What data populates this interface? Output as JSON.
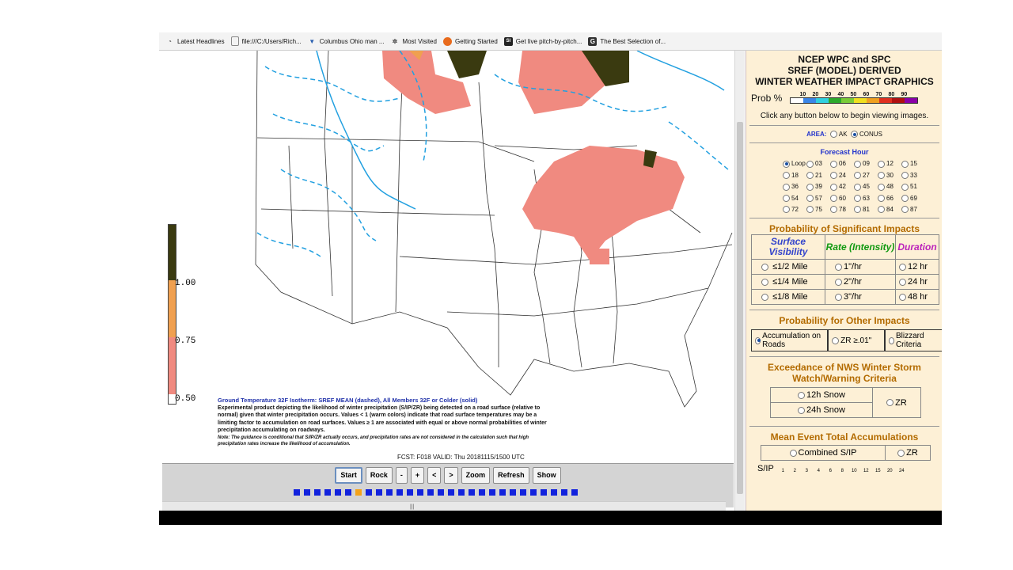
{
  "bookmarks": [
    {
      "label": "Latest Headlines",
      "icon": "rss-icon"
    },
    {
      "label": "file:///C:/Users/Rich...",
      "icon": "file-icon"
    },
    {
      "label": "Columbus Ohio man ...",
      "icon": "weather-icon"
    },
    {
      "label": "Most Visited",
      "icon": "gear-icon"
    },
    {
      "label": "Getting Started",
      "icon": "firefox-icon"
    },
    {
      "label": "Get live pitch-by-pitch...",
      "icon": "si-icon"
    },
    {
      "label": "The Best Selection of...",
      "icon": "g-icon"
    }
  ],
  "map": {
    "legend_ticks": [
      "1.00",
      "0.75",
      "0.50"
    ],
    "legend_colors": [
      "#3a3a10",
      "#f0a050",
      "#f08a80",
      "#ffffff"
    ],
    "caption_title": "Ground Temperature 32F Isotherm: SREF MEAN (dashed), All Members 32F or Colder (solid)",
    "caption_body": "Experimental product depicting the likelihood of winter precipitation (S/IP/ZR) being detected on a road surface (relative to normal) given that winter precipitation occurs.  Values < 1 (warm colors) indicate that road surface temperatures may be a limiting factor to accumulation on road surfaces. Values ≥ 1 are associated with equal or above normal probabilities of winter precipitation accumulating on roadways.",
    "caption_note": "Note: The guidance is conditional that S/IP/ZR actually occurs, and precipitation rates are not considered in the calculation such that high precipitation rates increase the likelihood of accumulation.",
    "fcst": "FCST: F018  VALID: Thu  20181115/1500 UTC"
  },
  "controls": {
    "buttons": [
      "Start",
      "Rock",
      "-",
      "+",
      "<",
      ">",
      "Zoom",
      "Refresh",
      "Show"
    ],
    "frame_count": 28,
    "active_frame": 6
  },
  "panel": {
    "title_lines": [
      "NCEP WPC and SPC",
      "SREF (MODEL) DERIVED",
      "WINTER WEATHER IMPACT GRAPHICS"
    ],
    "prob_label": "Prob %",
    "prob_ticks": [
      "10",
      "20",
      "30",
      "40",
      "50",
      "60",
      "70",
      "80",
      "90"
    ],
    "prob_colors": [
      "#ffffff",
      "#3a86e8",
      "#30d0e0",
      "#2caa2c",
      "#7acc38",
      "#f0e020",
      "#f0a020",
      "#e03020",
      "#b01010",
      "#8a00a8"
    ],
    "hint": "Click any button below to begin viewing images.",
    "area_label": "AREA:",
    "area_options": [
      "AK",
      "CONUS"
    ],
    "area_selected": "CONUS",
    "forecast_hour_label": "Forecast Hour",
    "forecast_hours": [
      "Loop",
      "03",
      "06",
      "09",
      "12",
      "15",
      "18",
      "21",
      "24",
      "27",
      "30",
      "33",
      "36",
      "39",
      "42",
      "45",
      "48",
      "51",
      "54",
      "57",
      "60",
      "63",
      "66",
      "69",
      "72",
      "75",
      "78",
      "81",
      "84",
      "87"
    ],
    "sig_title": "Probability of Significant Impacts",
    "sig_headers": [
      "Surface Visibility",
      "Rate (Intensity)",
      "Duration"
    ],
    "sig_rows": [
      [
        "≤1/2 Mile",
        "1\"/hr",
        "12 hr"
      ],
      [
        "≤1/4 Mile",
        "2\"/hr",
        "24 hr"
      ],
      [
        "≤1/8 Mile",
        "3\"/hr",
        "48 hr"
      ]
    ],
    "other_title": "Probability for Other Impacts",
    "other_options": [
      "Accumulation on Roads",
      "ZR ≥.01\"",
      "Blizzard Criteria"
    ],
    "exceed_title": "Exceedance of NWS Winter Storm Watch/Warning Criteria",
    "exceed_options": [
      "12h Snow",
      "24h Snow",
      "ZR"
    ],
    "mean_title": "Mean Event Total Accumulations",
    "mean_options": [
      "Combined S/IP",
      "ZR"
    ],
    "sip_label": "S/IP",
    "sip_ticks": [
      "1",
      "2",
      "3",
      "4",
      "6",
      "8",
      "10",
      "12",
      "15",
      "20",
      "24"
    ]
  }
}
